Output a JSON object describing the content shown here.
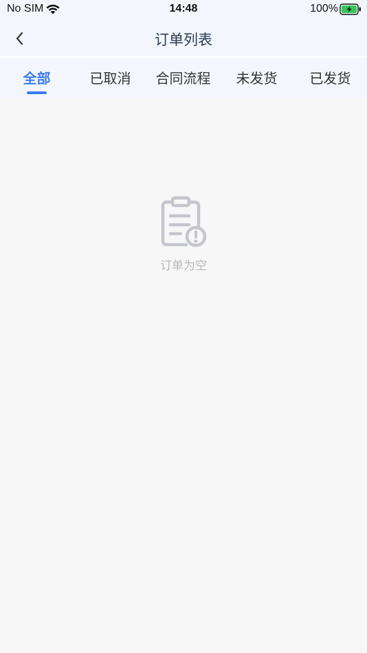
{
  "status_bar": {
    "carrier": "No SIM",
    "time": "14:48",
    "battery": "100%"
  },
  "nav": {
    "title": "订单列表"
  },
  "tabs": [
    {
      "label": "全部",
      "active": true
    },
    {
      "label": "已取消",
      "active": false
    },
    {
      "label": "合同流程",
      "active": false
    },
    {
      "label": "未发货",
      "active": false
    },
    {
      "label": "已发货",
      "active": false
    }
  ],
  "empty_state": {
    "message": "订单为空"
  },
  "colors": {
    "accent": "#3c7cf0",
    "header_bg": "#f3f7fd",
    "page_bg": "#f7f7f7",
    "empty_icon": "#c5c6cc",
    "battery_fill": "#34c759"
  }
}
